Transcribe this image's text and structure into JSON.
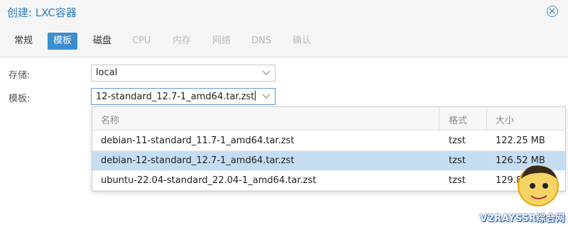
{
  "dialog": {
    "title": "创建: LXC容器",
    "close_icon": "close-circle-icon"
  },
  "tabs": [
    {
      "label": "常规",
      "state": "enabled"
    },
    {
      "label": "模板",
      "state": "active"
    },
    {
      "label": "磁盘",
      "state": "enabled"
    },
    {
      "label": "CPU",
      "state": "disabled"
    },
    {
      "label": "内存",
      "state": "disabled"
    },
    {
      "label": "网络",
      "state": "disabled"
    },
    {
      "label": "DNS",
      "state": "disabled"
    },
    {
      "label": "确认",
      "state": "disabled"
    }
  ],
  "form": {
    "storage": {
      "label": "存储:",
      "value": "local"
    },
    "template": {
      "label": "模板:",
      "value": "12-standard_12.7-1_amd64.tar.zst"
    }
  },
  "template_grid": {
    "columns": [
      "名称",
      "格式",
      "大小"
    ],
    "rows": [
      {
        "name": "debian-11-standard_11.7-1_amd64.tar.zst",
        "format": "tzst",
        "size": "122.25 MB",
        "selected": false
      },
      {
        "name": "debian-12-standard_12.7-1_amd64.tar.zst",
        "format": "tzst",
        "size": "126.52 MB",
        "selected": true
      },
      {
        "name": "ubuntu-22.04-standard_22.04-1_amd64.tar.zst",
        "format": "tzst",
        "size": "129.82 MB",
        "selected": false
      }
    ]
  },
  "watermark": {
    "text": "V2RAYSSR综合网"
  },
  "colors": {
    "accent": "#3c8dce",
    "title": "#2f7fbf",
    "selected_row": "#c4ddf2"
  }
}
